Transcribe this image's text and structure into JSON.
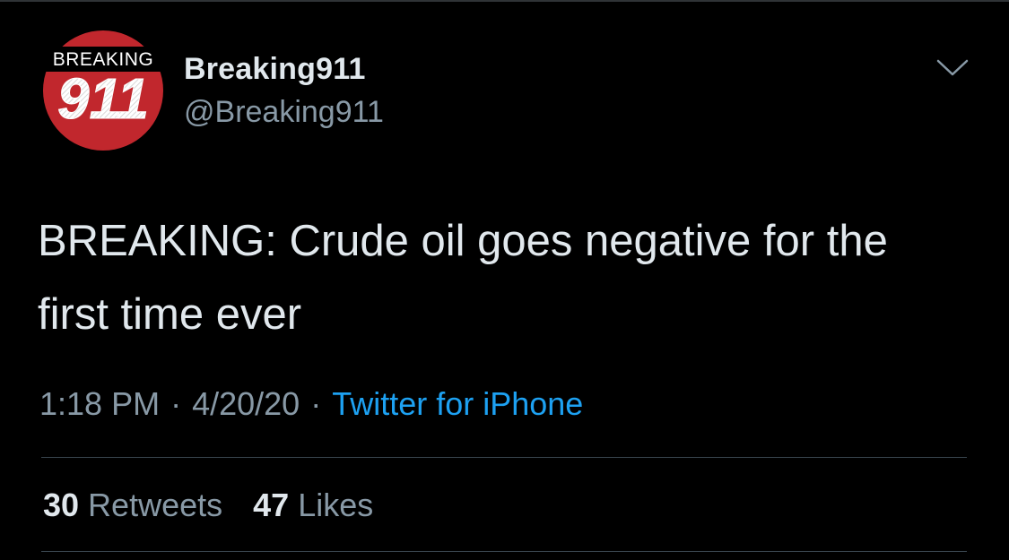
{
  "tweet": {
    "author": {
      "display_name": "Breaking911",
      "handle": "@Breaking911",
      "avatar": {
        "icon": "breaking911-logo-icon",
        "logo_top_text": "BREAKING",
        "logo_number": "911",
        "color": "#c1272d"
      }
    },
    "more_icon": "chevron-down-icon",
    "text": "BREAKING: Crude oil goes negative for the first time ever",
    "time": "1:18 PM",
    "separator": "·",
    "date": "4/20/20",
    "source": "Twitter for iPhone",
    "stats": {
      "retweets_count": "30",
      "retweets_label": "Retweets",
      "likes_count": "47",
      "likes_label": "Likes"
    }
  },
  "colors": {
    "background": "#000000",
    "primary_text": "#e1e8ed",
    "secondary_text": "#8899a6",
    "link": "#1da1f2",
    "divider": "#38444d"
  }
}
